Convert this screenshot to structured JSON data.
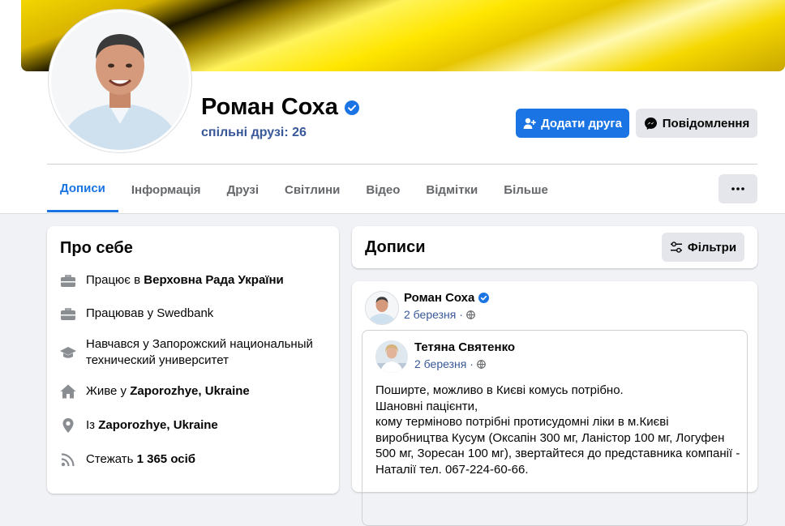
{
  "profile": {
    "name": "Роман Соха",
    "mutual_friends": "спільні друзі: 26",
    "add_friend_label": "Додати друга",
    "message_label": "Повідомлення"
  },
  "tabs": [
    {
      "label": "Дописи",
      "active": true
    },
    {
      "label": "Інформація"
    },
    {
      "label": "Друзі"
    },
    {
      "label": "Світлини"
    },
    {
      "label": "Відео"
    },
    {
      "label": "Відмітки"
    },
    {
      "label": "Більше"
    }
  ],
  "more_button": "•••",
  "about": {
    "title": "Про себе",
    "items": [
      {
        "icon": "briefcase-icon",
        "prefix": "Працює в ",
        "bold": "Верховна Рада України"
      },
      {
        "icon": "briefcase-icon",
        "prefix": "Працював у Swedbank",
        "bold": ""
      },
      {
        "icon": "graduation-cap-icon",
        "prefix": "Навчався у Запорожский национальный технический университет",
        "bold": ""
      },
      {
        "icon": "home-icon",
        "prefix": "Живе у ",
        "bold": "Zaporozhye, Ukraine"
      },
      {
        "icon": "location-pin-icon",
        "prefix": "Із ",
        "bold": "Zaporozhye, Ukraine"
      },
      {
        "icon": "rss-icon",
        "prefix": "Стежать ",
        "bold": "1 365 осіб"
      }
    ]
  },
  "posts": {
    "title": "Дописи",
    "filter_label": "Фільтри"
  },
  "post": {
    "author": "Роман Соха",
    "date": "2 березня · ",
    "shared": {
      "author": "Тетяна Святенко",
      "date": "2 березня · ",
      "lines": [
        "Поширте, можливо в Києві комусь потрібно.",
        "Шановні пацієнти,",
        "кому терміново потрібні протисудомні ліки в м.Києві",
        "виробництва Кусум (Оксапін 300 мг, Ланістор 100 мг, Логуфен",
        "500 мг, Зоресан 100 мг), звертайтеся до представника компанії -",
        "Наталії тел. 067-224-60-66."
      ]
    }
  },
  "colors": {
    "accent": "#1b74e4",
    "link": "#385898",
    "cover": "#ffe600"
  }
}
